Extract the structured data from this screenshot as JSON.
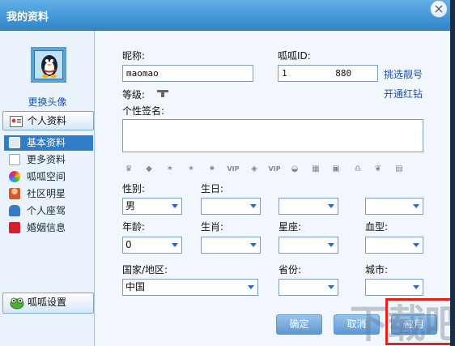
{
  "window": {
    "title": "我的资料"
  },
  "sidebar": {
    "change_avatar": "更换头像",
    "personal_section": "个人资料",
    "items": [
      {
        "label": "基本资料",
        "active": true,
        "icon": "id-card-icon"
      },
      {
        "label": "更多资料",
        "active": false,
        "icon": "document-icon"
      },
      {
        "label": "呱呱空间",
        "active": false,
        "icon": "palette-icon"
      },
      {
        "label": "社区明星",
        "active": false,
        "icon": "person-icon"
      },
      {
        "label": "个人座驾",
        "active": false,
        "icon": "car-icon"
      },
      {
        "label": "婚姻信息",
        "active": false,
        "icon": "marriage-icon"
      }
    ],
    "settings_section": "呱呱设置"
  },
  "form": {
    "nickname_label": "昵称:",
    "nickname_value": "maomao",
    "id_label": "呱呱ID:",
    "id_value": "1         880",
    "pick_number_link": "挑选靓号",
    "level_label": "等级:",
    "red_diamond_link": "开通红钻",
    "signature_label": "个性签名:",
    "badges": [
      "crown-icon",
      "diamond-icon",
      "star-icon",
      "star-icon",
      "star-icon",
      "vip-icon",
      "gem-icon",
      "vip-icon",
      "ingot-icon",
      "grid-icon",
      "flag-icon",
      "bell-icon",
      "heart-icon",
      "box-icon"
    ],
    "gender_label": "性别:",
    "gender_value": "男",
    "birthday_label": "生日:",
    "age_label": "年龄:",
    "age_value": "0",
    "zodiac_label": "生肖:",
    "constellation_label": "星座:",
    "blood_label": "血型:",
    "country_label": "国家/地区:",
    "country_value": "中国",
    "province_label": "省份:",
    "city_label": "城市:"
  },
  "buttons": {
    "ok": "确定",
    "cancel": "取消",
    "apply": "应用"
  },
  "watermark": "下载吧",
  "colors": {
    "title_bar": "#2f86c8",
    "active_item": "#2f7cc8",
    "link": "#1f55a6",
    "highlight": "#e4221b"
  }
}
